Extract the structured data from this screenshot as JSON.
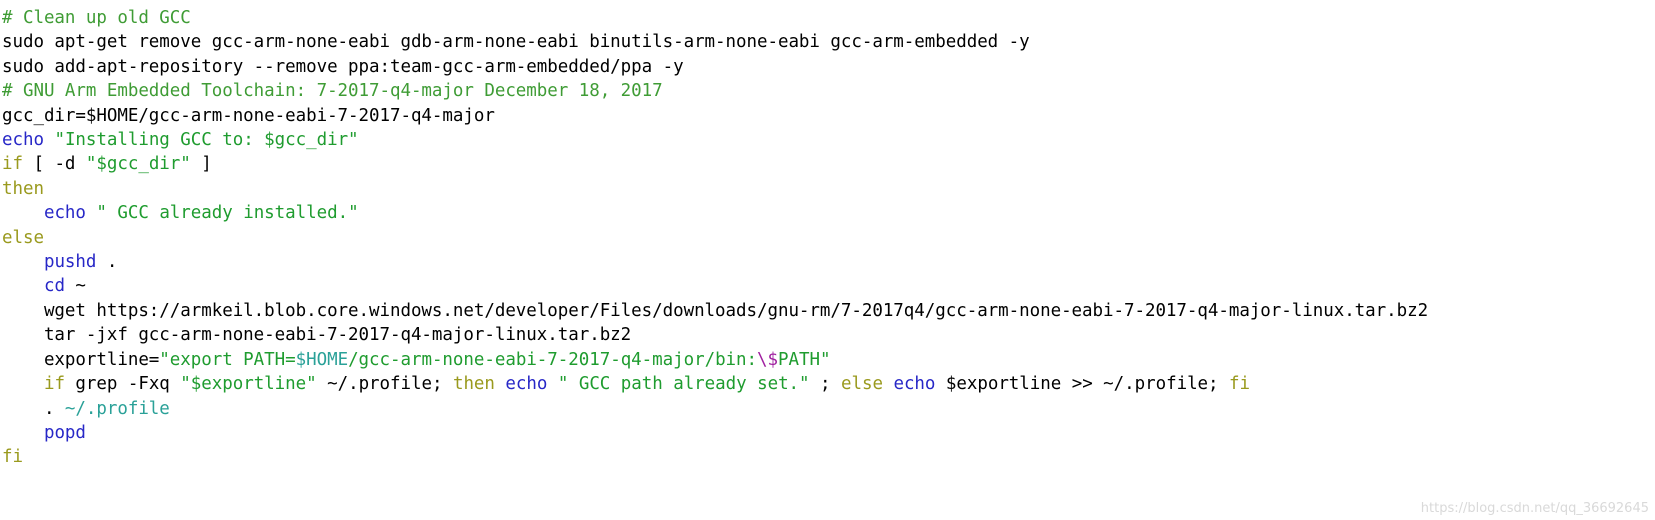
{
  "code_block": {
    "language": "shell",
    "background_color": "#ffffff",
    "default_text_color": "#000000",
    "token_colors": {
      "comment": "#3f9c35",
      "keyword": "#9a9a1e",
      "builtin": "#2727c7",
      "string": "#1f9c2f",
      "variable": "#2aa198",
      "escape": "#a020a0",
      "plain": "#000000"
    },
    "lines": [
      {
        "id": "line-1",
        "tokens": [
          {
            "type": "comment",
            "text": "# Clean up old GCC"
          }
        ]
      },
      {
        "id": "line-2",
        "tokens": [
          {
            "type": "plain",
            "text": "sudo apt-get remove gcc-arm-none-eabi gdb-arm-none-eabi binutils-arm-none-eabi gcc-arm-embedded -y"
          }
        ]
      },
      {
        "id": "line-3",
        "tokens": [
          {
            "type": "plain",
            "text": "sudo add-apt-repository --remove ppa:team-gcc-arm-embedded/ppa -y"
          }
        ]
      },
      {
        "id": "line-4",
        "tokens": [
          {
            "type": "plain",
            "text": ""
          }
        ]
      },
      {
        "id": "line-5",
        "tokens": [
          {
            "type": "plain",
            "text": ""
          }
        ]
      },
      {
        "id": "line-6",
        "tokens": [
          {
            "type": "comment",
            "text": "# GNU Arm Embedded Toolchain: 7-2017-q4-major December 18, 2017"
          }
        ]
      },
      {
        "id": "line-7",
        "tokens": [
          {
            "type": "plain",
            "text": "gcc_dir=$HOME/gcc-arm-none-eabi-7-2017-q4-major"
          }
        ]
      },
      {
        "id": "line-8",
        "tokens": [
          {
            "type": "builtin",
            "text": "echo"
          },
          {
            "type": "plain",
            "text": " "
          },
          {
            "type": "string",
            "text": "\"Installing GCC to: $gcc_dir\""
          }
        ]
      },
      {
        "id": "line-9",
        "tokens": [
          {
            "type": "keyword",
            "text": "if"
          },
          {
            "type": "plain",
            "text": " [ -d "
          },
          {
            "type": "string",
            "text": "\"$gcc_dir\""
          },
          {
            "type": "plain",
            "text": " ]"
          }
        ]
      },
      {
        "id": "line-10",
        "tokens": [
          {
            "type": "keyword",
            "text": "then"
          }
        ]
      },
      {
        "id": "line-11",
        "tokens": [
          {
            "type": "plain",
            "text": "    "
          },
          {
            "type": "builtin",
            "text": "echo"
          },
          {
            "type": "plain",
            "text": " "
          },
          {
            "type": "string",
            "text": "\" GCC already installed.\""
          }
        ]
      },
      {
        "id": "line-12",
        "tokens": [
          {
            "type": "keyword",
            "text": "else"
          }
        ]
      },
      {
        "id": "line-13",
        "tokens": [
          {
            "type": "plain",
            "text": "    "
          },
          {
            "type": "builtin",
            "text": "pushd"
          },
          {
            "type": "plain",
            "text": " ."
          }
        ]
      },
      {
        "id": "line-14",
        "tokens": [
          {
            "type": "plain",
            "text": "    "
          },
          {
            "type": "builtin",
            "text": "cd"
          },
          {
            "type": "plain",
            "text": " ~"
          }
        ]
      },
      {
        "id": "line-15",
        "tokens": [
          {
            "type": "plain",
            "text": "    wget https://armkeil.blob.core.windows.net/developer/Files/downloads/gnu-rm/7-2017q4/gcc-arm-none-eabi-7-2017-q4-major-linux.tar.bz2"
          }
        ]
      },
      {
        "id": "line-16",
        "tokens": [
          {
            "type": "plain",
            "text": "    tar -jxf gcc-arm-none-eabi-7-2017-q4-major-linux.tar.bz2"
          }
        ]
      },
      {
        "id": "line-17",
        "tokens": [
          {
            "type": "plain",
            "text": "    exportline="
          },
          {
            "type": "string",
            "text": "\"export PATH="
          },
          {
            "type": "variable",
            "text": "$HOME"
          },
          {
            "type": "string",
            "text": "/gcc-arm-none-eabi-7-2017-q4-major/bin:"
          },
          {
            "type": "escape",
            "text": "\\$"
          },
          {
            "type": "string",
            "text": "PATH\""
          }
        ]
      },
      {
        "id": "line-18",
        "tokens": [
          {
            "type": "plain",
            "text": "    "
          },
          {
            "type": "keyword",
            "text": "if"
          },
          {
            "type": "plain",
            "text": " grep -Fxq "
          },
          {
            "type": "string",
            "text": "\"$exportline\""
          },
          {
            "type": "plain",
            "text": " ~/.profile; "
          },
          {
            "type": "keyword",
            "text": "then"
          },
          {
            "type": "plain",
            "text": " "
          },
          {
            "type": "builtin",
            "text": "echo"
          },
          {
            "type": "plain",
            "text": " "
          },
          {
            "type": "string",
            "text": "\" GCC path already set.\""
          },
          {
            "type": "plain",
            "text": " ; "
          },
          {
            "type": "keyword",
            "text": "else"
          },
          {
            "type": "plain",
            "text": " "
          },
          {
            "type": "builtin",
            "text": "echo"
          },
          {
            "type": "plain",
            "text": " $exportline >> ~/.profile; "
          },
          {
            "type": "keyword",
            "text": "fi"
          }
        ]
      },
      {
        "id": "line-19",
        "tokens": [
          {
            "type": "plain",
            "text": "    . "
          },
          {
            "type": "variable",
            "text": "~/.profile"
          }
        ]
      },
      {
        "id": "line-20",
        "tokens": [
          {
            "type": "plain",
            "text": "    "
          },
          {
            "type": "builtin",
            "text": "popd"
          }
        ]
      },
      {
        "id": "line-21",
        "tokens": [
          {
            "type": "keyword",
            "text": "fi"
          }
        ]
      }
    ]
  },
  "watermark": {
    "text": "https://blog.csdn.net/qq_36692645",
    "color": "#d9d9d9"
  }
}
